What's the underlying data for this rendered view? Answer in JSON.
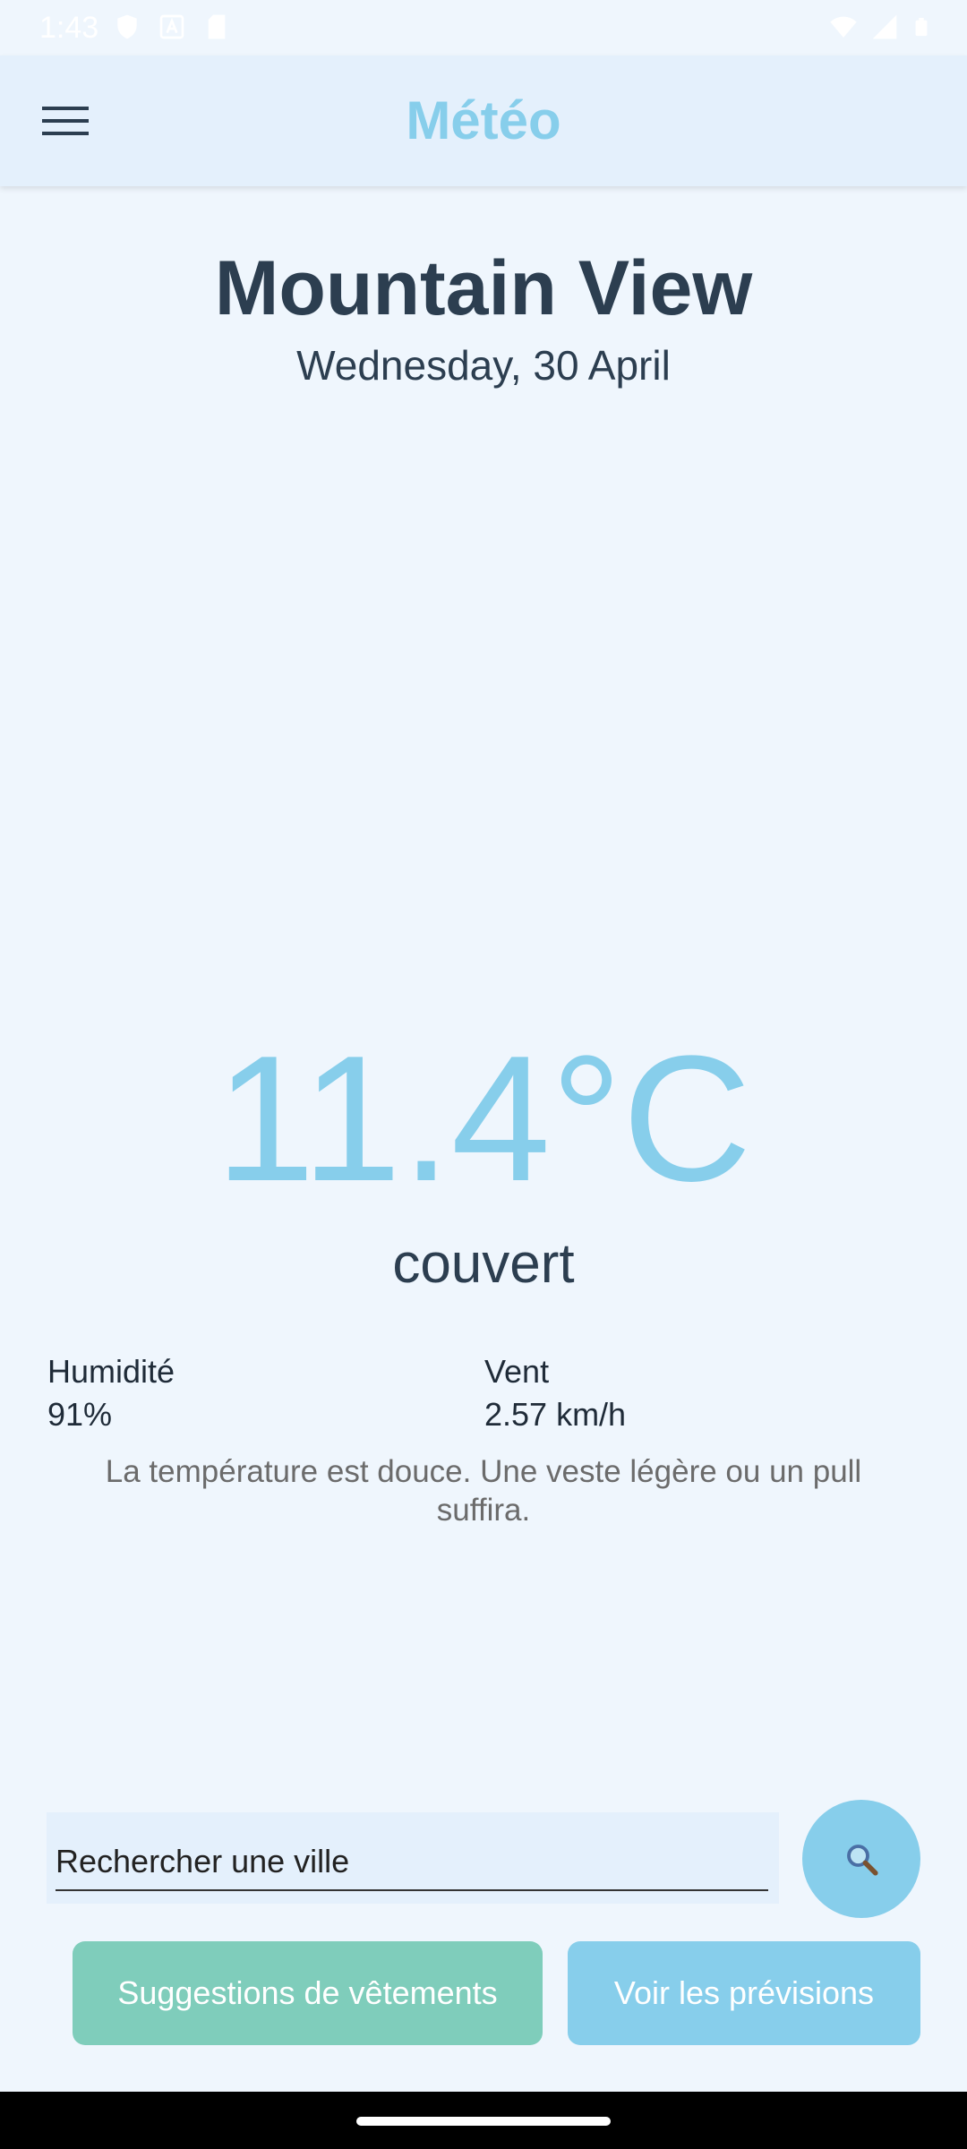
{
  "status_bar": {
    "time": "1:43",
    "icons_left": [
      "shield-icon",
      "font-icon",
      "sd-card-icon"
    ],
    "icons_right": [
      "wifi-icon",
      "signal-icon",
      "battery-icon"
    ]
  },
  "app_bar": {
    "title": "Météo",
    "menu_icon": "hamburger-menu-icon"
  },
  "weather": {
    "city": "Mountain View",
    "date": "Wednesday, 30 April",
    "temperature": "11.4°C",
    "condition": "couvert",
    "humidity_label": "Humidité",
    "humidity_value": "91%",
    "wind_label": "Vent",
    "wind_value": "2.57 km/h",
    "advice": "La température est douce. Une veste légère ou un pull suffira."
  },
  "search": {
    "placeholder": "Rechercher une ville",
    "button_icon": "search-icon"
  },
  "buttons": {
    "clothes_label": "Suggestions de vêtements",
    "forecast_label": "Voir les prévisions"
  },
  "colors": {
    "accent": "#87ceeb",
    "clothes_button": "#7fcdbb",
    "background": "#eff6fd",
    "app_bar": "#e4f0fc",
    "text_dark": "#2c3e50"
  }
}
